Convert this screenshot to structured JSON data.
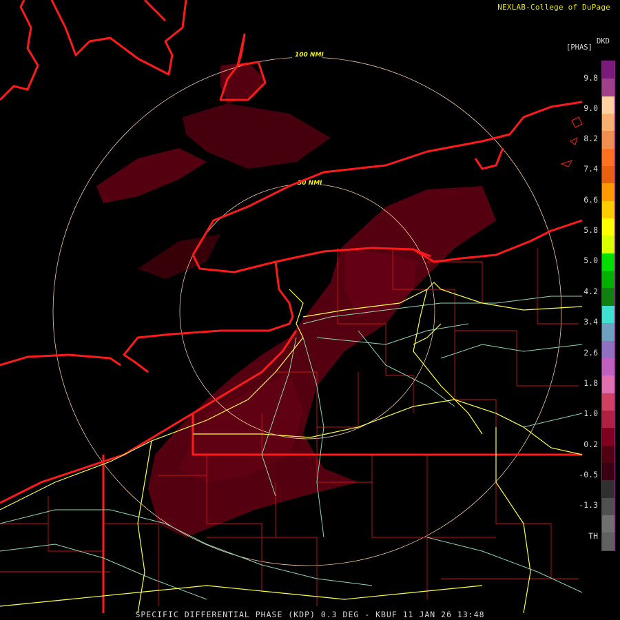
{
  "credit": "NEXLAB-College of DuPage",
  "caption": "SPECIFIC DIFFERENTIAL PHASE (KDP) 0.3 DEG - KBUF 11 JAN 26 13:48",
  "legend": {
    "product": "DKD",
    "unit": "[PHAS]",
    "ticks": [
      "9.8",
      "9.0",
      "8.2",
      "7.4",
      "6.6",
      "5.8",
      "5.0",
      "4.2",
      "3.4",
      "2.6",
      "1.8",
      "1.0",
      "0.2",
      "-0.5",
      "-1.3",
      "TH"
    ],
    "colors": [
      "#7a1a7a",
      "#a0408a",
      "#ffd0a0",
      "#f8b070",
      "#f09050",
      "#ff7020",
      "#e86010",
      "#ff9900",
      "#ffcc00",
      "#ffff00",
      "#d8ff00",
      "#00e000",
      "#00b000",
      "#108010",
      "#40e0d0",
      "#70a0c0",
      "#9070c0",
      "#c060c0",
      "#e070b0",
      "#d04060",
      "#b02040",
      "#800020",
      "#500010",
      "#380010",
      "#303030",
      "#505050",
      "#707070",
      "#606060"
    ]
  },
  "range_rings": [
    "100 NMI",
    "50 NMI"
  ],
  "colors": {
    "boundary": "#ff1a1a",
    "county": "#c81414",
    "interstate": "#ffff40",
    "highway": "#8ed8b0",
    "ring": "#f4c8a0",
    "echo": "#5a0012"
  }
}
